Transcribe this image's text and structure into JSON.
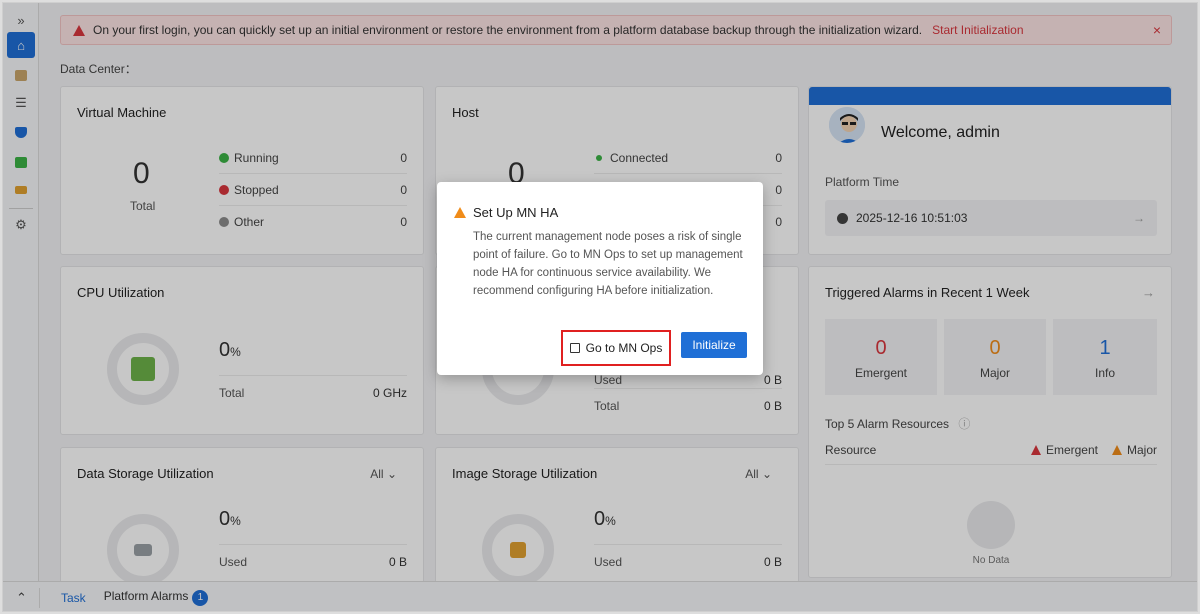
{
  "banner": {
    "message": "On your first login, you can quickly set up an initial environment or restore the environment from a platform database backup through the initialization wizard.",
    "link": "Start Initialization",
    "close": "×"
  },
  "data_center_label": "Data Center：",
  "vm_card": {
    "title": "Virtual Machine",
    "total_value": "0",
    "total_label": "Total",
    "rows": [
      {
        "label": "Running",
        "value": "0",
        "color": "#3bb346"
      },
      {
        "label": "Stopped",
        "value": "0",
        "color": "#d9363e"
      },
      {
        "label": "Other",
        "value": "0",
        "color": "#8c8c8c"
      }
    ]
  },
  "host_card": {
    "title": "Host",
    "total_value": "0",
    "rows": [
      {
        "label": "Connected",
        "value": "0",
        "color": "#3bb346"
      },
      {
        "label": "",
        "value": "0"
      },
      {
        "label": "",
        "value": "0"
      }
    ]
  },
  "welcome_card": {
    "greeting": "Welcome, admin",
    "platform_time_label": "Platform Time",
    "platform_time": "2025-12-16 10:51:03"
  },
  "cpu_card": {
    "title": "CPU Utilization",
    "percent": "0",
    "percent_unit": "%",
    "total_label": "Total",
    "total_value": "0 GHz"
  },
  "memory_card": {
    "used_label": "Used",
    "used_value": "0 B",
    "total_label": "Total",
    "total_value": "0 B"
  },
  "alarms_card": {
    "title": "Triggered Alarms in Recent 1 Week",
    "boxes": [
      {
        "value": "0",
        "label": "Emergent",
        "color": "#d9363e"
      },
      {
        "value": "0",
        "label": "Major",
        "color": "#f08c1a"
      },
      {
        "value": "1",
        "label": "Info",
        "color": "#1f6fd6"
      }
    ],
    "top5_label": "Top 5 Alarm Resources",
    "resource_label": "Resource",
    "emergent_label": "Emergent",
    "major_label": "Major",
    "no_data": "No Data"
  },
  "data_storage_card": {
    "title": "Data Storage Utilization",
    "filter": "All",
    "percent": "0",
    "percent_unit": "%",
    "used_label": "Used",
    "used_value": "0 B"
  },
  "image_storage_card": {
    "title": "Image Storage Utilization",
    "filter": "All",
    "percent": "0",
    "percent_unit": "%",
    "used_label": "Used",
    "used_value": "0 B"
  },
  "bottombar": {
    "task": "Task",
    "platform_alarms": "Platform Alarms",
    "alarm_count": "1"
  },
  "modal": {
    "title": "Set Up MN HA",
    "body": "The current management node poses a risk of single point of failure. Go to MN Ops to set up management node HA for continuous service availability. We recommend configuring HA before initialization.",
    "ops_button": "Go to MN Ops",
    "init_button": "Initialize"
  },
  "colors": {
    "accent": "#1f6fd6",
    "danger": "#d9363e",
    "warning": "#f08c1a",
    "success": "#3bb346"
  }
}
